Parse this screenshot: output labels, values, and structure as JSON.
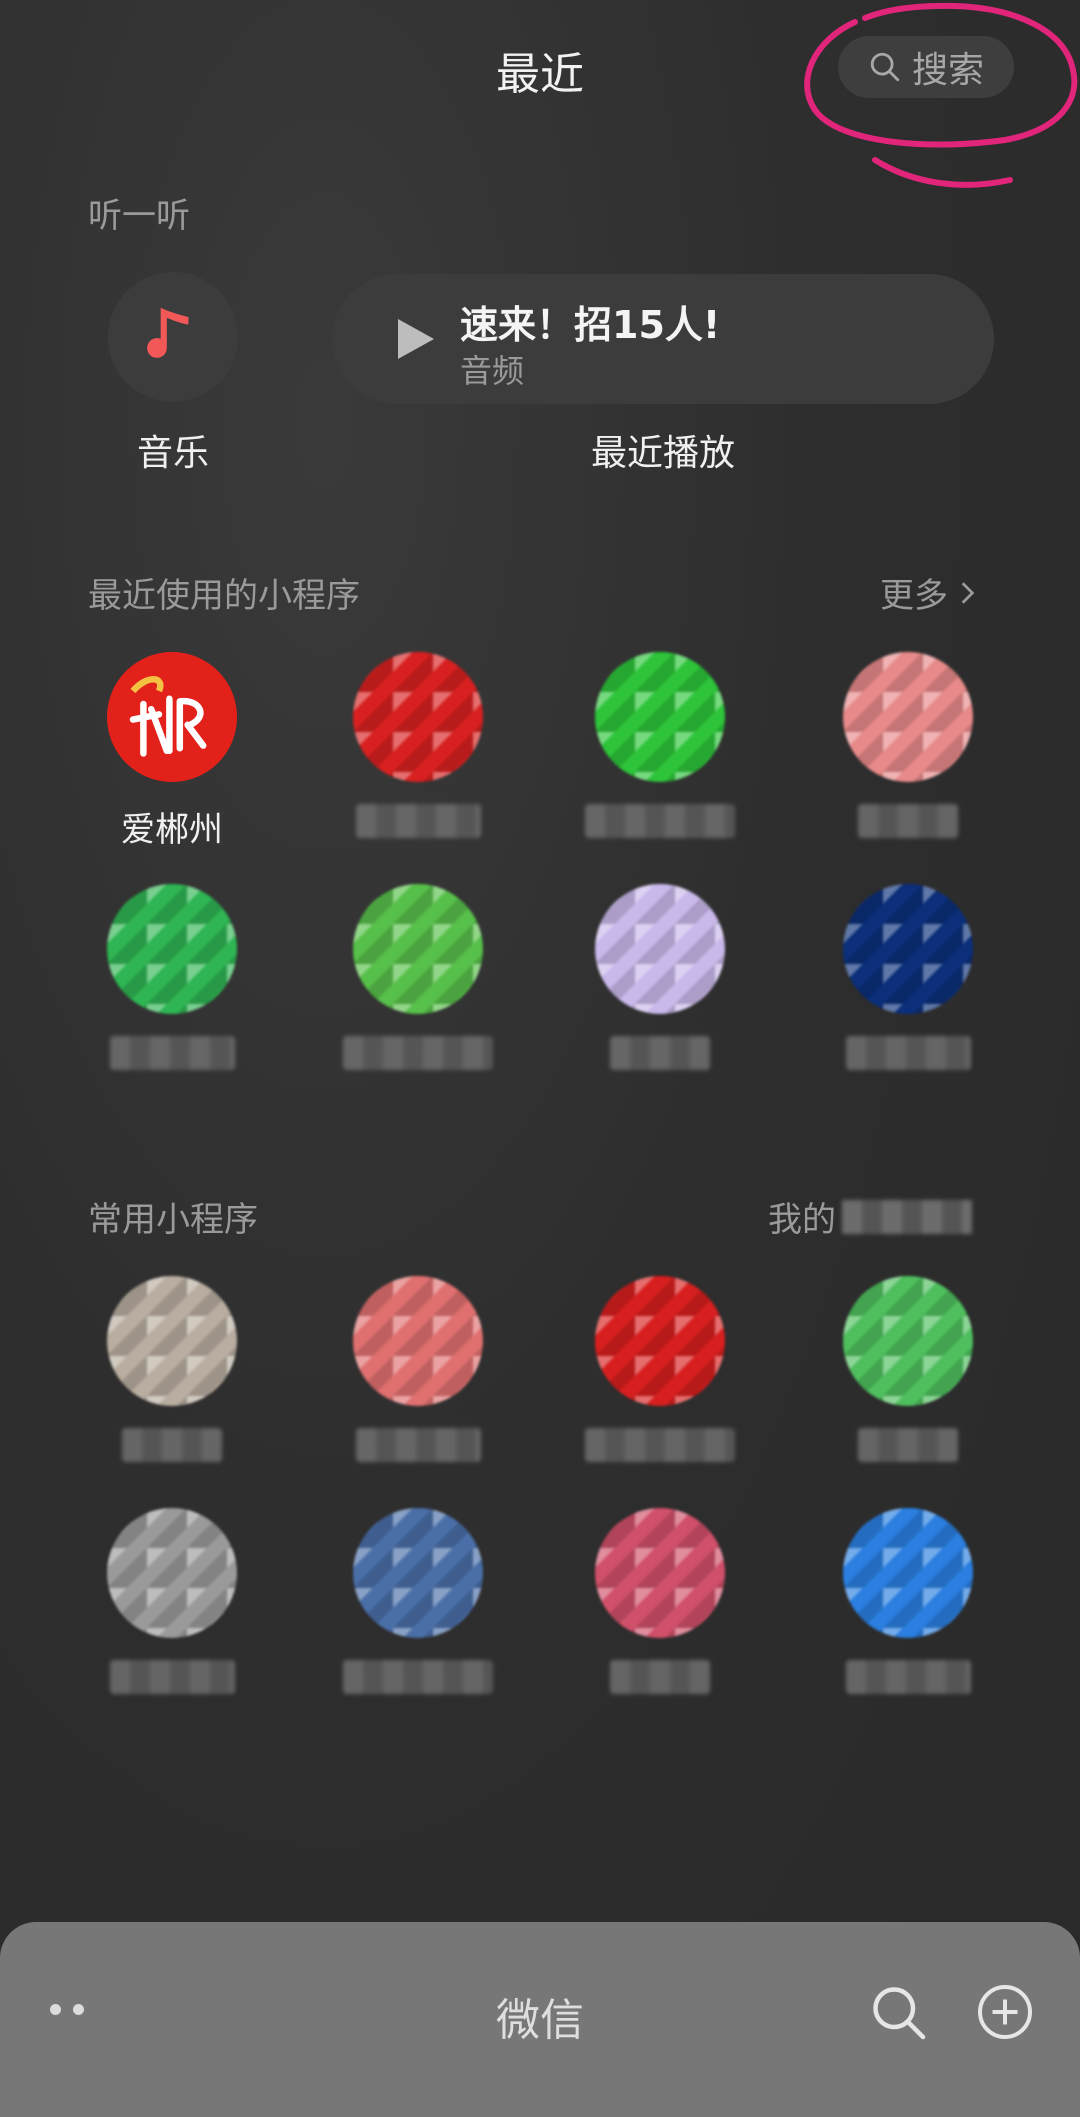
{
  "header": {
    "title": "最近",
    "search_label": "搜索"
  },
  "listen": {
    "section_label": "听一听",
    "music_label": "音乐",
    "recent_title": "速来！招15人!",
    "recent_subtitle": "音频",
    "recent_label": "最近播放"
  },
  "recent_programs": {
    "section_label": "最近使用的小程序",
    "more_label": "更多",
    "apps": [
      {
        "label": "爱郴州",
        "color": "#e3211b",
        "blurred": false
      },
      {
        "label": "",
        "color": "#d92020",
        "blurred": true
      },
      {
        "label": "",
        "color": "#2dc43a",
        "blurred": true
      },
      {
        "label": "",
        "color": "#e88a8a",
        "blurred": true
      },
      {
        "label": "",
        "color": "#2fb553",
        "blurred": true
      },
      {
        "label": "",
        "color": "#57c04a",
        "blurred": true
      },
      {
        "label": "",
        "color": "#c9b8ea",
        "blurred": true
      },
      {
        "label": "",
        "color": "#0b2f7a",
        "blurred": true
      }
    ]
  },
  "common_programs": {
    "section_label": "常用小程序",
    "more_label": "我的",
    "apps": [
      {
        "label": "",
        "color": "#b9ada0",
        "blurred": true
      },
      {
        "label": "",
        "color": "#e07070",
        "blurred": true
      },
      {
        "label": "",
        "color": "#d81f1f",
        "blurred": true
      },
      {
        "label": "",
        "color": "#4fbf5e",
        "blurred": true
      },
      {
        "label": "",
        "color": "#9a9a9a",
        "blurred": true
      },
      {
        "label": "",
        "color": "#4a6fa8",
        "blurred": true
      },
      {
        "label": "",
        "color": "#d0506a",
        "blurred": true
      },
      {
        "label": "",
        "color": "#2a7fe0",
        "blurred": true
      }
    ]
  },
  "bottom_bar": {
    "title": "微信"
  },
  "colors": {
    "accent_music": "#f25858",
    "annotation": "#e0257a"
  }
}
